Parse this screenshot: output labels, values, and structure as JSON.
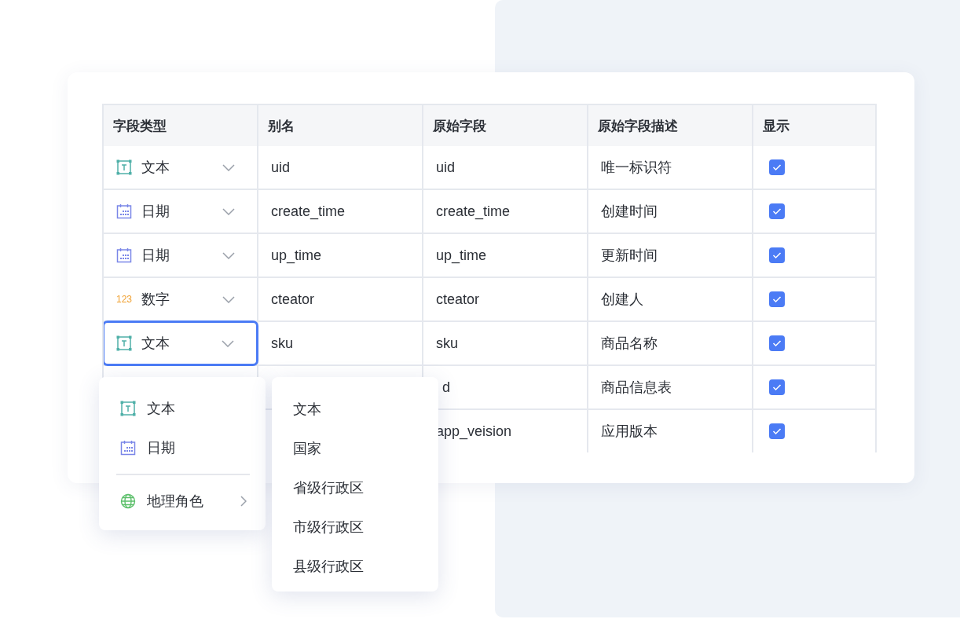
{
  "table": {
    "columns": [
      "字段类型",
      "别名",
      "原始字段",
      "原始字段描述",
      "显示"
    ],
    "rows": [
      {
        "type": {
          "kind": "text",
          "label": "文本",
          "focused": false
        },
        "alias": "uid",
        "field": "uid",
        "description": "唯一标识符",
        "show": true
      },
      {
        "type": {
          "kind": "date",
          "label": "日期",
          "focused": false
        },
        "alias": "create_time",
        "field": "create_time",
        "description": "创建时间",
        "show": true
      },
      {
        "type": {
          "kind": "date",
          "label": "日期",
          "focused": false
        },
        "alias": "up_time",
        "field": "up_time",
        "description": "更新时间",
        "show": true
      },
      {
        "type": {
          "kind": "number",
          "label": "数字",
          "icon_label": "123",
          "focused": false
        },
        "alias": "cteator",
        "field": "cteator",
        "description": "创建人",
        "show": true
      },
      {
        "type": {
          "kind": "text",
          "label": "文本",
          "focused": true
        },
        "alias": "sku",
        "field": "sku",
        "description": "商品名称",
        "show": true
      },
      {
        "field": "d",
        "field_covered": true,
        "description": "商品信息表",
        "show": true
      },
      {
        "field": "app_veision",
        "description": "应用版本",
        "show": true
      }
    ]
  },
  "type_menu": {
    "items": [
      {
        "kind": "text",
        "label": "文本"
      },
      {
        "kind": "date",
        "label": "日期"
      },
      {
        "kind": "divider"
      },
      {
        "kind": "globe",
        "label": "地理角色",
        "submenu": true
      }
    ]
  },
  "submenu": {
    "items": [
      "文本",
      "国家",
      "省级行政区",
      "市级行政区",
      "县级行政区"
    ]
  }
}
